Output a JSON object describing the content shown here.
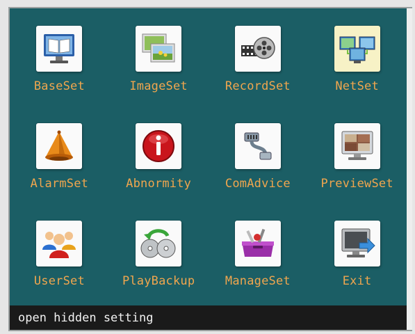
{
  "menu": {
    "items": [
      {
        "label": "BaseSet",
        "icon": "book-monitor-icon"
      },
      {
        "label": "ImageSet",
        "icon": "image-frames-icon"
      },
      {
        "label": "RecordSet",
        "icon": "film-reel-icon"
      },
      {
        "label": "NetSet",
        "icon": "network-monitors-icon",
        "selected": true
      },
      {
        "label": "AlarmSet",
        "icon": "alarm-bell-icon"
      },
      {
        "label": "Abnormity",
        "icon": "info-warning-icon"
      },
      {
        "label": "ComAdvice",
        "icon": "cable-plug-icon"
      },
      {
        "label": "PreviewSet",
        "icon": "preview-monitor-icon"
      },
      {
        "label": "UserSet",
        "icon": "users-icon"
      },
      {
        "label": "PlayBackup",
        "icon": "disc-backup-icon"
      },
      {
        "label": "ManageSet",
        "icon": "toolbox-icon"
      },
      {
        "label": "Exit",
        "icon": "exit-monitor-icon"
      }
    ]
  },
  "status": {
    "text": "open hidden setting"
  },
  "colors": {
    "background": "#1b5e65",
    "label": "#f0a64e",
    "selected_tile": "#f7f2c6",
    "status_bar": "#1a1a1a"
  }
}
